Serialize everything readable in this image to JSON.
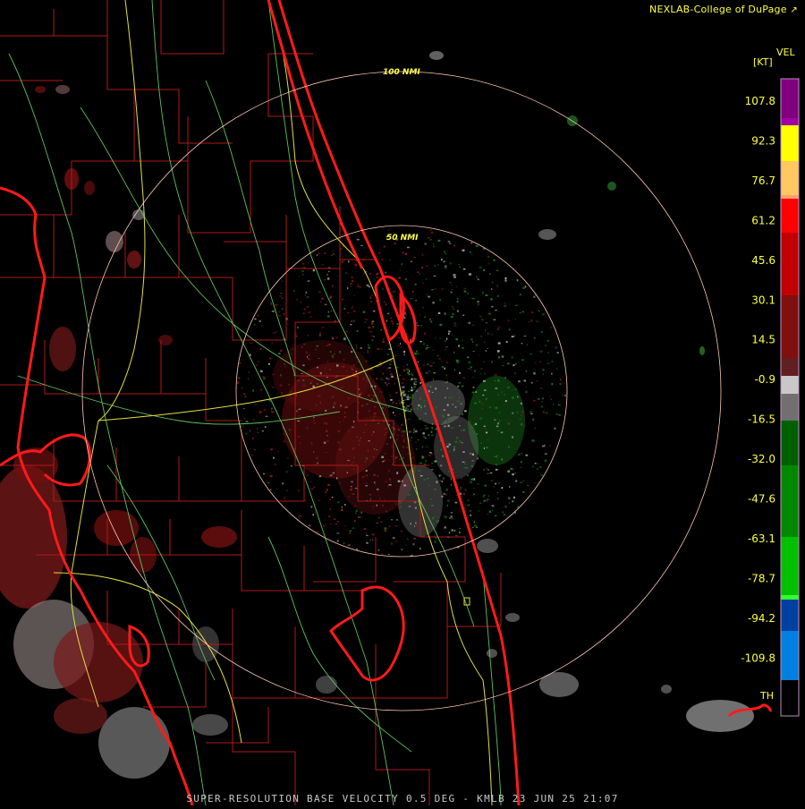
{
  "credit": "NEXLAB-College of DuPage",
  "credit_icon": "external-link-icon",
  "legend": {
    "unit_name": "VEL",
    "unit": "[KT]",
    "labels": [
      "107.8",
      "92.3",
      "76.7",
      "61.2",
      "45.6",
      "30.1",
      "14.5",
      "-0.9",
      "-16.5",
      "-32.0",
      "-47.6",
      "-63.1",
      "-78.7",
      "-94.2",
      "-109.8"
    ],
    "th_label": "TH",
    "colors": [
      "#800080",
      "#ffff00",
      "#ffa060",
      "#ff0000",
      "#a00000",
      "#5a1010",
      "#c8c8c8",
      "#008000",
      "#00ff00",
      "#0050c0",
      "#00b0ff"
    ]
  },
  "rings": [
    {
      "label": "100 NMI",
      "range_nmi": 100
    },
    {
      "label": "50 NMI",
      "range_nmi": 50
    }
  ],
  "footer": "SUPER-RESOLUTION BASE VELOCITY 0.5 DEG - KMLB 23 JUN 25 21:07",
  "colors": {
    "background": "#000000",
    "coast": "#ff1a1a",
    "county": "#b01818",
    "roads_green": "#60c060",
    "roads_yellow": "#e0e040",
    "ring": "#ffc8b0",
    "ring_label": "#ffff40"
  }
}
